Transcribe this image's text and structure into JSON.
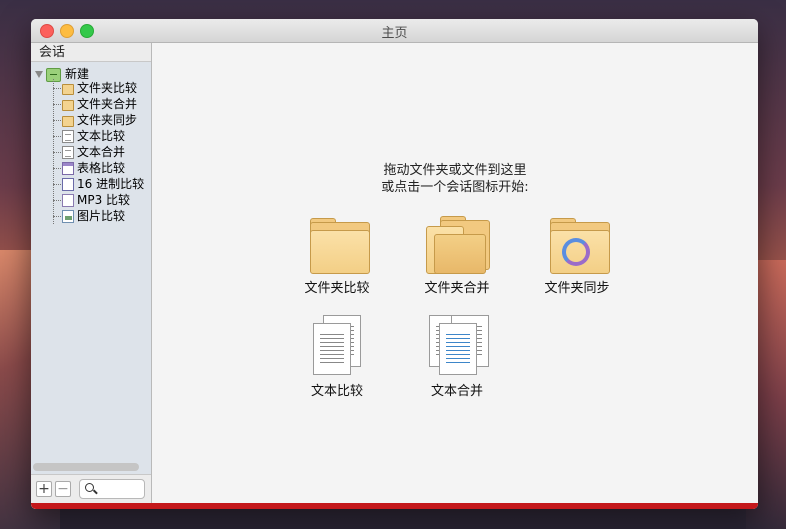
{
  "window": {
    "title": "主页"
  },
  "sidebar": {
    "header": "会话",
    "root": "新建",
    "items": [
      {
        "label": "文件夹比较",
        "icon": "folder-icon"
      },
      {
        "label": "文件夹合并",
        "icon": "folder-merge-icon"
      },
      {
        "label": "文件夹同步",
        "icon": "folder-sync-icon"
      },
      {
        "label": "文本比较",
        "icon": "document-icon"
      },
      {
        "label": "文本合并",
        "icon": "document-merge-icon"
      },
      {
        "label": "表格比较",
        "icon": "table-icon"
      },
      {
        "label": "16 进制比较",
        "icon": "hex-icon"
      },
      {
        "label": "MP3 比较",
        "icon": "music-file-icon"
      },
      {
        "label": "图片比较",
        "icon": "image-icon"
      }
    ],
    "footer": {
      "add": "+",
      "remove": "−"
    }
  },
  "main": {
    "prompt_line1": "拖动文件夹或文件到这里",
    "prompt_line2": "或点击一个会话图标开始:",
    "tiles": [
      {
        "label": "文件夹比较"
      },
      {
        "label": "文件夹合并"
      },
      {
        "label": "文件夹同步"
      },
      {
        "label": "文本比较"
      },
      {
        "label": "文本合并"
      }
    ]
  },
  "colors": {
    "accent_bar": "#c4181b",
    "folder": "#f2c980"
  }
}
